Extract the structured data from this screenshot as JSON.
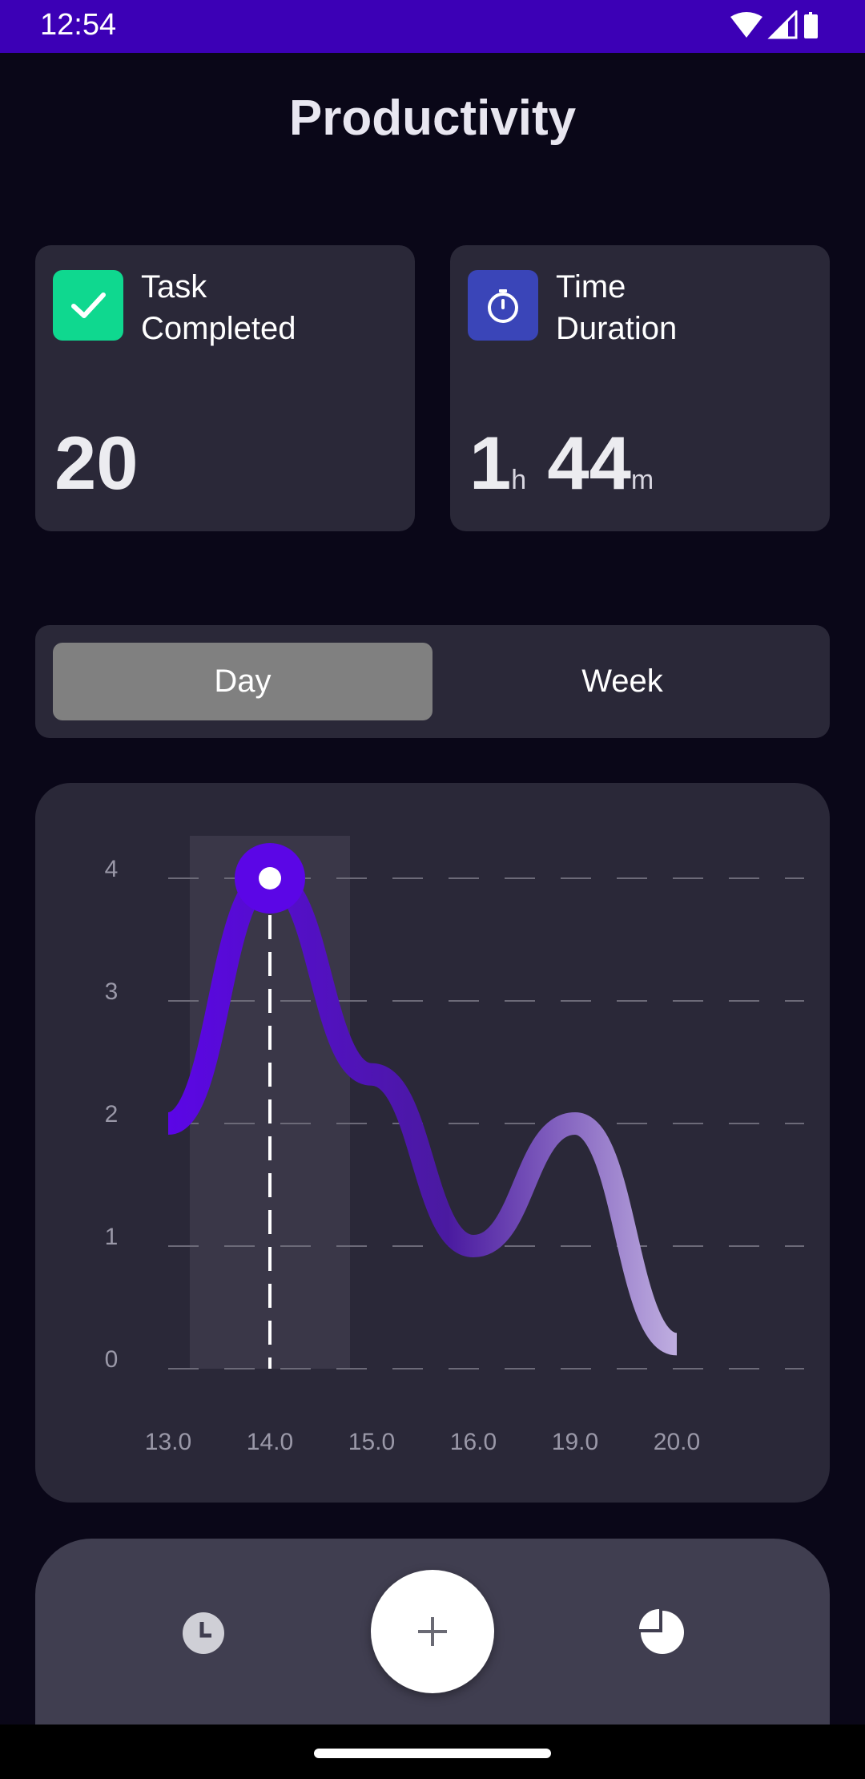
{
  "status_bar": {
    "time": "12:54"
  },
  "page": {
    "title": "Productivity"
  },
  "cards": {
    "tasks": {
      "label_line1": "Task",
      "label_line2": "Completed",
      "value": "20"
    },
    "duration": {
      "label_line1": "Time",
      "label_line2": "Duration",
      "hours": "1",
      "hours_unit": "h",
      "minutes": "44",
      "minutes_unit": "m"
    }
  },
  "segmented": {
    "day": "Day",
    "week": "Week",
    "selected": "Day"
  },
  "chart_data": {
    "type": "line",
    "categories": [
      "13.0",
      "14.0",
      "15.0",
      "16.0",
      "19.0",
      "20.0"
    ],
    "values": [
      2,
      4,
      2.4,
      1,
      2,
      0.2
    ],
    "yticks": [
      "0",
      "1",
      "2",
      "3",
      "4"
    ],
    "ylim": [
      0,
      4
    ],
    "highlighted_index": 1,
    "grid": "dashed horizontal",
    "line_color_start": "#5b06e6",
    "line_color_end": "#bfaee0"
  },
  "bottom_nav": {
    "left": "clock-icon",
    "center": "plus-icon",
    "right": "pie-chart-icon"
  },
  "colors": {
    "status_bar": "#3c00b6",
    "background": "#0a0718",
    "card": "#2a2838",
    "task_icon": "#0fd88f",
    "duration_icon": "#3a45b8",
    "segment_selected": "#808080"
  }
}
